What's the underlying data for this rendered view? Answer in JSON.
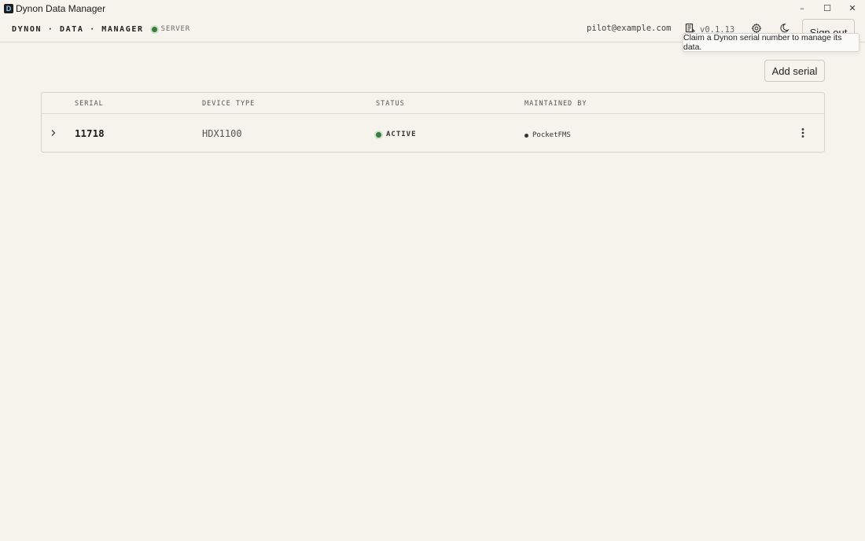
{
  "window": {
    "title": "Dynon Data Manager",
    "app_icon_letter": "D",
    "controls": {
      "minimize": "–",
      "maximize": "☐",
      "close": "✕"
    }
  },
  "header": {
    "brand": "DYNON · DATA · MANAGER",
    "server_label": "SERVER",
    "server_status_color": "#3b7a3f",
    "user_email": "pilot@example.com",
    "version": "v0.1.13",
    "sign_out_label": "Sign out"
  },
  "tooltip": {
    "text": "Claim a Dynon serial number to manage its data."
  },
  "toolbar": {
    "add_serial_label": "Add serial"
  },
  "table": {
    "columns": [
      "SERIAL",
      "DEVICE TYPE",
      "STATUS",
      "MAINTAINED BY"
    ],
    "rows": [
      {
        "serial": "11718",
        "device_type": "HDX1100",
        "status": "ACTIVE",
        "maintained_by": "PocketFMS"
      }
    ]
  }
}
